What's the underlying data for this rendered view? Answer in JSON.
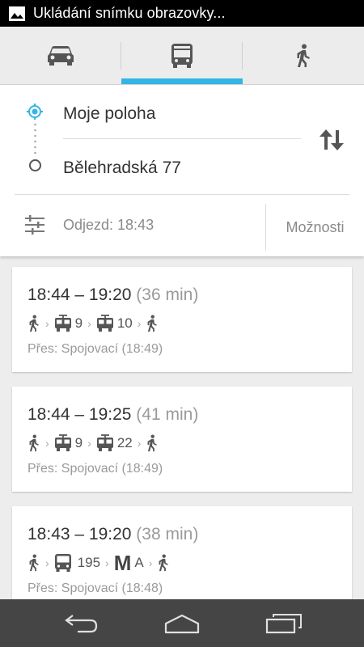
{
  "status_bar": {
    "text": "Ukládání snímku obrazovky...",
    "icon": "picture-icon"
  },
  "mode_tabs": [
    {
      "name": "car",
      "icon": "car-icon",
      "selected": false
    },
    {
      "name": "transit",
      "icon": "bus-icon",
      "selected": true
    },
    {
      "name": "walk",
      "icon": "walk-icon",
      "selected": false
    }
  ],
  "route": {
    "origin": "Moje poloha",
    "destination": "Bělehradská 77",
    "departure": "Odjezd: 18:43",
    "options_label": "Možnosti"
  },
  "results": [
    {
      "time": "18:44 – 19:20",
      "duration": "(36 min)",
      "legs": [
        {
          "type": "walk"
        },
        {
          "type": "tram",
          "line": "9"
        },
        {
          "type": "tram",
          "line": "10"
        },
        {
          "type": "walk"
        }
      ],
      "via": "Přes: Spojovací (18:49)"
    },
    {
      "time": "18:44 – 19:25",
      "duration": "(41 min)",
      "legs": [
        {
          "type": "walk"
        },
        {
          "type": "tram",
          "line": "9"
        },
        {
          "type": "tram",
          "line": "22"
        },
        {
          "type": "walk"
        }
      ],
      "via": "Přes: Spojovací (18:49)"
    },
    {
      "time": "18:43 – 19:20",
      "duration": "(38 min)",
      "legs": [
        {
          "type": "walk"
        },
        {
          "type": "bus",
          "line": "195"
        },
        {
          "type": "metro",
          "line": "A"
        },
        {
          "type": "walk"
        }
      ],
      "via": "Přes: Spojovací (18:48)"
    }
  ],
  "colors": {
    "accent": "#33b5e5",
    "status_bar": "#000000",
    "nav_bar": "#454545"
  },
  "nav_bar": {
    "back": "back-icon",
    "home": "home-icon",
    "recents": "recents-icon"
  }
}
